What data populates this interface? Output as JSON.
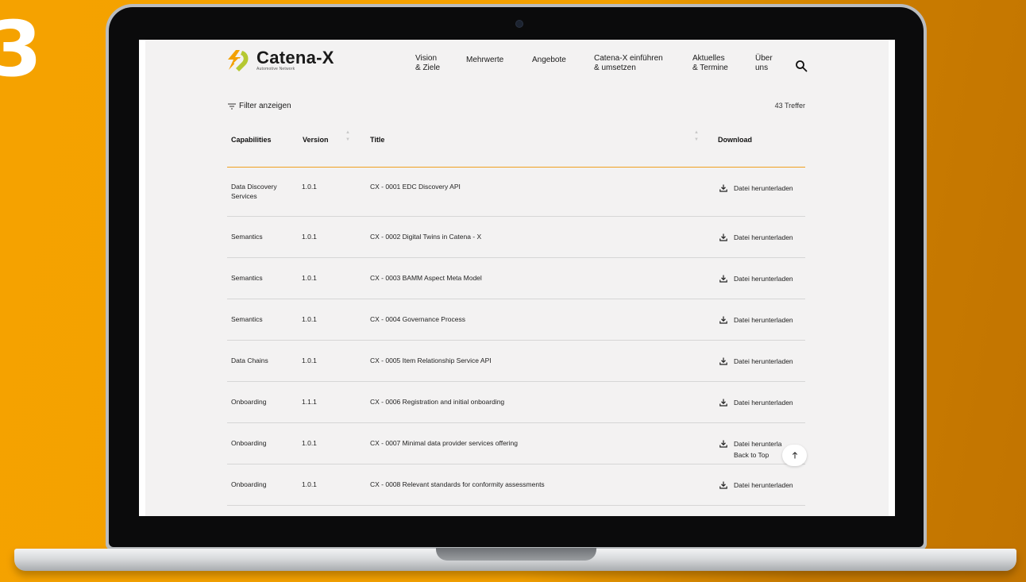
{
  "slide": {
    "number": "3"
  },
  "brand": {
    "name": "Catena-X",
    "tagline": "Automotive Network",
    "colors": {
      "orange": "#f3a000",
      "green": "#b5c832",
      "accent_rule": "#f0a020"
    }
  },
  "nav": {
    "items": [
      {
        "label": "Vision\n& Ziele"
      },
      {
        "label": "Mehrwerte"
      },
      {
        "label": "Angebote"
      },
      {
        "label": "Catena-X einführen\n& umsetzen"
      },
      {
        "label": "Aktuelles\n& Termine"
      },
      {
        "label": "Über\nuns"
      }
    ],
    "search_icon": "search-icon"
  },
  "toolbar": {
    "filter_label": "Filter anzeigen",
    "hit_count": "43 Treffer"
  },
  "table": {
    "headers": {
      "capabilities": "Capabilities",
      "version": "Version",
      "title": "Title",
      "download": "Download"
    },
    "rows": [
      {
        "capability": "Data Discovery Services",
        "version": "1.0.1",
        "title": "CX - 0001 EDC Discovery API",
        "download": "Datei herunterladen"
      },
      {
        "capability": "Semantics",
        "version": "1.0.1",
        "title": "CX - 0002 Digital Twins in Catena - X",
        "download": "Datei herunterladen"
      },
      {
        "capability": "Semantics",
        "version": "1.0.1",
        "title": "CX - 0003 BAMM Aspect Meta Model",
        "download": "Datei herunterladen"
      },
      {
        "capability": "Semantics",
        "version": "1.0.1",
        "title": "CX - 0004 Governance Process",
        "download": "Datei herunterladen"
      },
      {
        "capability": "Data Chains",
        "version": "1.0.1",
        "title": "CX - 0005 Item Relationship Service API",
        "download": "Datei herunterladen"
      },
      {
        "capability": "Onboarding",
        "version": "1.1.1",
        "title": "CX - 0006 Registration and initial onboarding",
        "download": "Datei herunterladen"
      },
      {
        "capability": "Onboarding",
        "version": "1.0.1",
        "title": "CX - 0007 Minimal data provider services offering",
        "download": "Datei herunterla"
      },
      {
        "capability": "Onboarding",
        "version": "1.0.1",
        "title": "CX - 0008 Relevant standards for conformity assessments",
        "download": "Datei herunterladen"
      }
    ]
  },
  "back_to_top": {
    "label": "Back to Top"
  }
}
